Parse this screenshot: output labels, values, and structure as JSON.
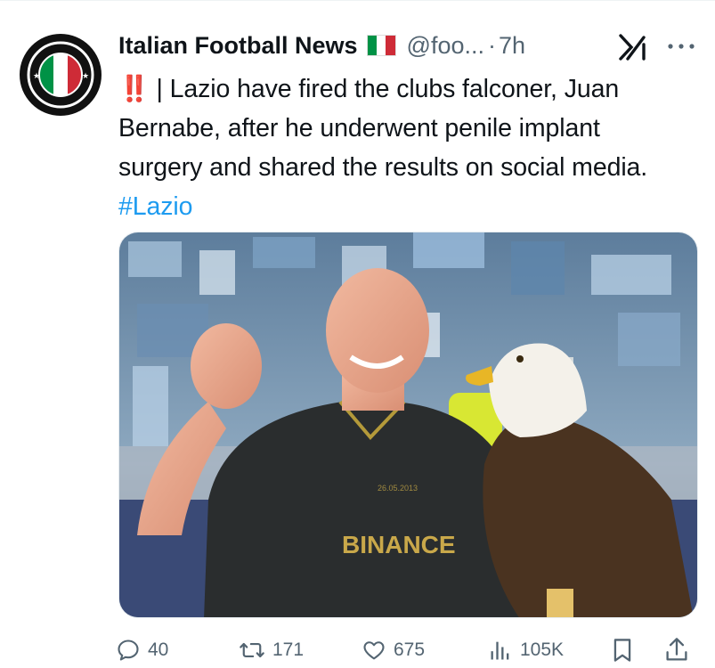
{
  "author": {
    "name": "Italian Football News",
    "handle": "@foo...",
    "time": "7h",
    "separator": "·"
  },
  "tweet": {
    "emoji": "‼️",
    "text": "| Lazio have fired the clubs falconer, Juan Bernabe, after he underwent penile implant surgery and shared the results on social media.",
    "hashtag": "#Lazio"
  },
  "media": {
    "shirt_sponsor": "BINANCE",
    "shirt_date": "26.05.2013"
  },
  "actions": {
    "replies": "40",
    "retweets": "171",
    "likes": "675",
    "views": "105K"
  },
  "colors": {
    "link": "#1d9bf0",
    "muted": "#536471",
    "text": "#0f1419",
    "flag_green": "#009246",
    "flag_white": "#ffffff",
    "flag_red": "#ce2b37"
  },
  "icons": [
    "avatar-logo",
    "italy-flag-icon",
    "grok-icon",
    "more-icon",
    "reply-icon",
    "retweet-icon",
    "like-icon",
    "views-icon",
    "bookmark-icon",
    "share-icon"
  ]
}
